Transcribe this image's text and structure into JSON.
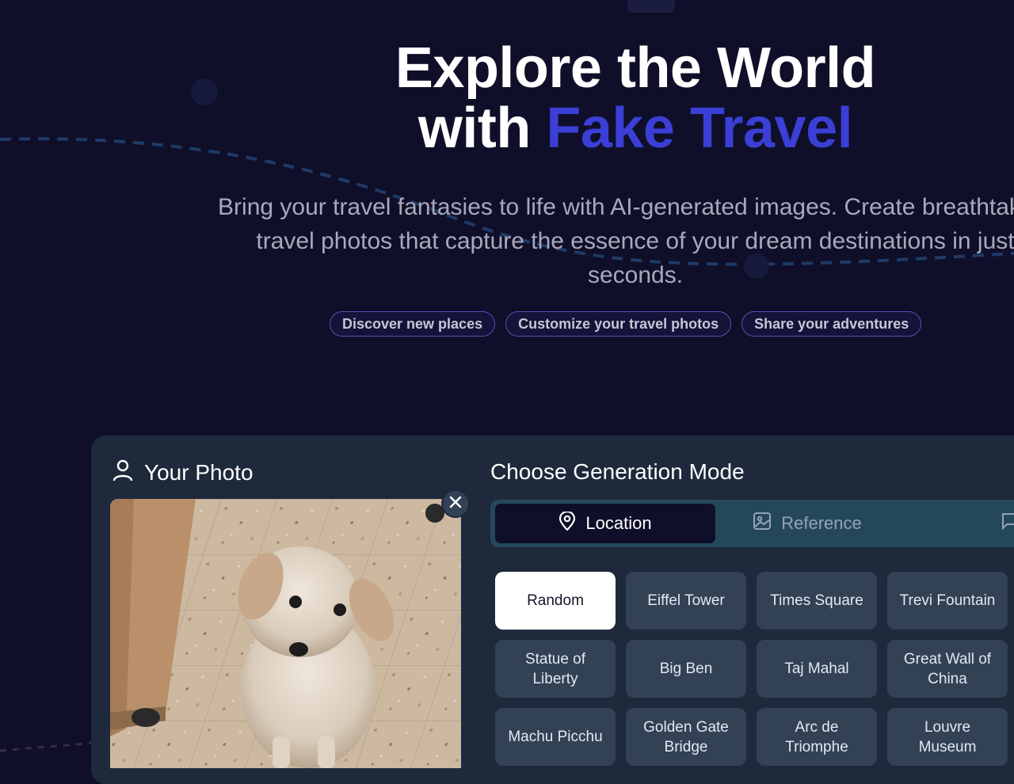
{
  "hero": {
    "title_line1": "Explore the World",
    "title_line2_prefix": "with ",
    "title_line2_accent": "Fake Travel",
    "subtitle_line1": "Bring your travel fantasies to life with AI-generated images. Create breathtaking",
    "subtitle_line2": "travel photos that capture the essence of your dream destinations in just",
    "subtitle_line3": "seconds.",
    "pills": [
      "Discover new places",
      "Customize your travel photos",
      "Share your adventures"
    ]
  },
  "photo": {
    "title": "Your Photo",
    "icon": "user-icon",
    "remove_icon": "close-icon"
  },
  "mode": {
    "title": "Choose Generation Mode",
    "tabs": [
      {
        "label": "Location",
        "icon": "map-pin-icon",
        "active": true
      },
      {
        "label": "Reference",
        "icon": "image-icon",
        "active": false
      },
      {
        "label": "",
        "icon": "message-icon",
        "active": false
      }
    ],
    "locations": [
      {
        "label": "Random",
        "selected": true
      },
      {
        "label": "Eiffel Tower",
        "selected": false
      },
      {
        "label": "Times Square",
        "selected": false
      },
      {
        "label": "Trevi Fountain",
        "selected": false
      },
      {
        "label": "Statue of Liberty",
        "selected": false
      },
      {
        "label": "Big Ben",
        "selected": false
      },
      {
        "label": "Taj Mahal",
        "selected": false
      },
      {
        "label": "Great Wall of China",
        "selected": false
      },
      {
        "label": "Machu Picchu",
        "selected": false
      },
      {
        "label": "Golden Gate Bridge",
        "selected": false
      },
      {
        "label": "Arc de Triomphe",
        "selected": false
      },
      {
        "label": "Louvre Museum",
        "selected": false
      }
    ]
  },
  "colors": {
    "background": "#0f0f29",
    "accent": "#3b3fd6",
    "panel": "#1e293b",
    "tab_bar": "#24485a",
    "chip": "#334155"
  }
}
